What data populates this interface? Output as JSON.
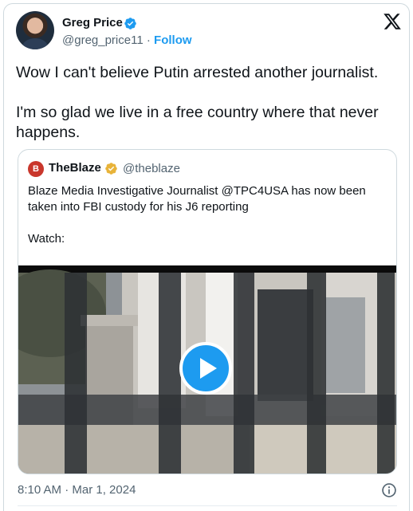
{
  "author": {
    "name": "Greg Price",
    "handle": "@greg_price11",
    "separator": " · ",
    "follow_label": "Follow"
  },
  "tweet": {
    "text": "Wow I can't believe Putin arrested another journalist.\n\nI'm so glad we live in a free country where that never happens."
  },
  "quoted_tweet": {
    "name": "TheBlaze",
    "avatar_letter": "B",
    "handle": "@theblaze",
    "text": "Blaze Media Investigative Journalist @TPC4USA has now been taken into FBI custody for his J6 reporting\n\nWatch:"
  },
  "footer": {
    "timestamp": "8:10 AM · Mar 1, 2024"
  },
  "colors": {
    "accent": "#1d9bf0",
    "gold_badge": "#e8b339",
    "blaze_red": "#c9372c"
  }
}
